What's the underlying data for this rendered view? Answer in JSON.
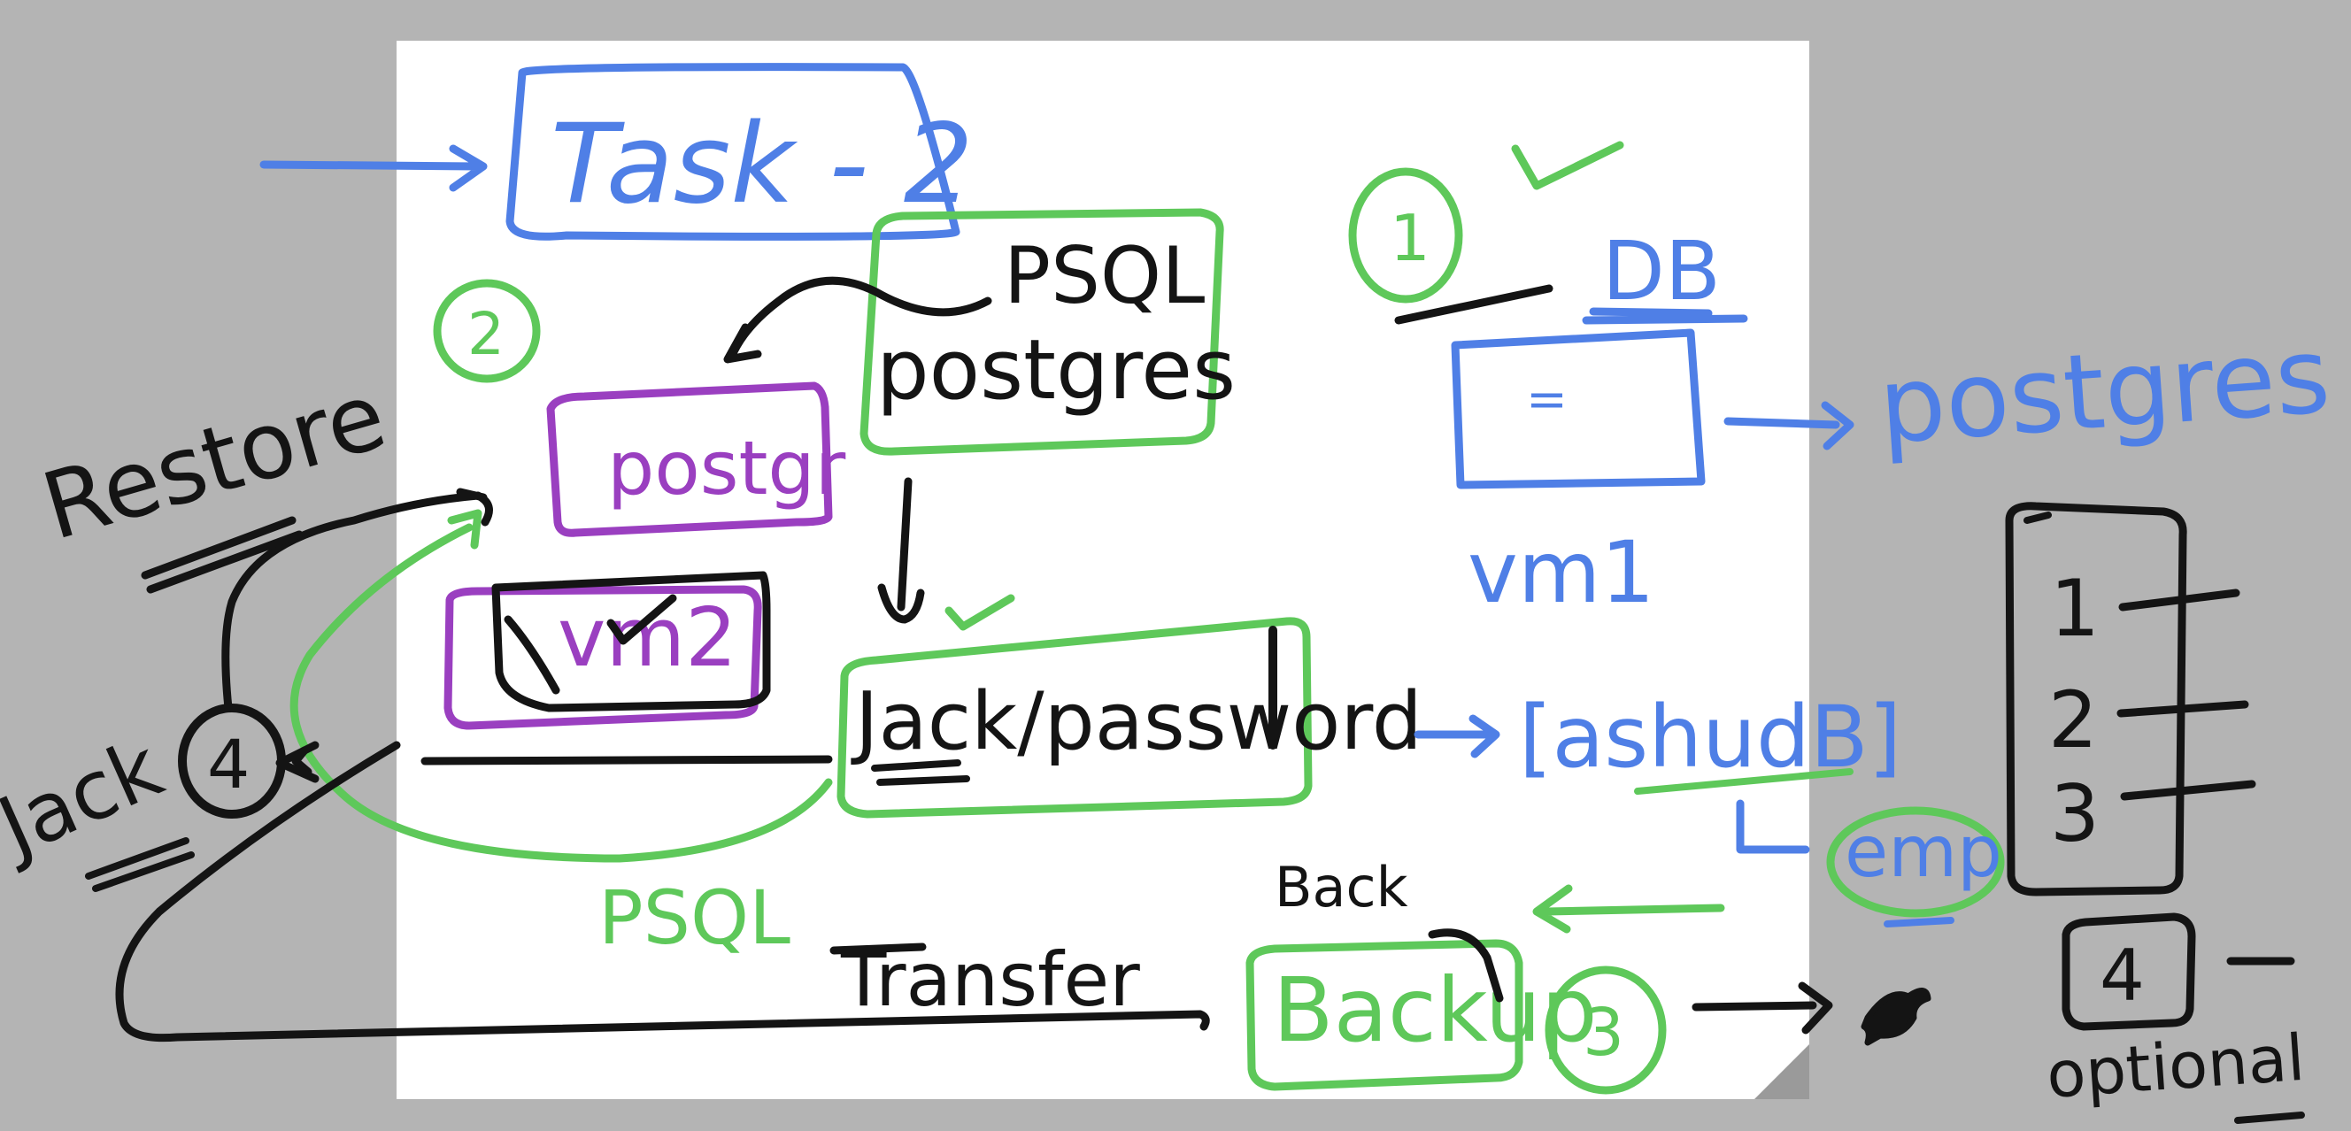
{
  "colors": {
    "background": "#b4b4b4",
    "page": "#ffffff",
    "blue": "#4f7fe6",
    "green": "#5ec85a",
    "black": "#141414",
    "purple": "#9a3fc0"
  },
  "labels": {
    "task": "Task - 2",
    "psql_top": "PSQL",
    "postgres_box": "postgres",
    "postgr_purple": "postgr",
    "vm2": "vm2",
    "jack_password": "Jack/password",
    "psql_bottom": "PSQL",
    "transfer": "Transfer",
    "backup_above": "Back",
    "backup": "Backup",
    "db": "DB",
    "db_inner": "=",
    "postgres_right": "postgres",
    "vm1": "vm1",
    "ashudb": "[ashudB]",
    "emp": "emp",
    "restore": "Restore",
    "jack_left": "Jack",
    "optional": "optional"
  },
  "step_numbers": {
    "one": "1",
    "two": "2",
    "three": "3",
    "four_left": "4",
    "four_right": "4"
  },
  "list": {
    "items": [
      "1",
      "2",
      "3"
    ]
  },
  "icons": [
    "checkmark-icon",
    "arrow-icon",
    "bird-icon"
  ]
}
